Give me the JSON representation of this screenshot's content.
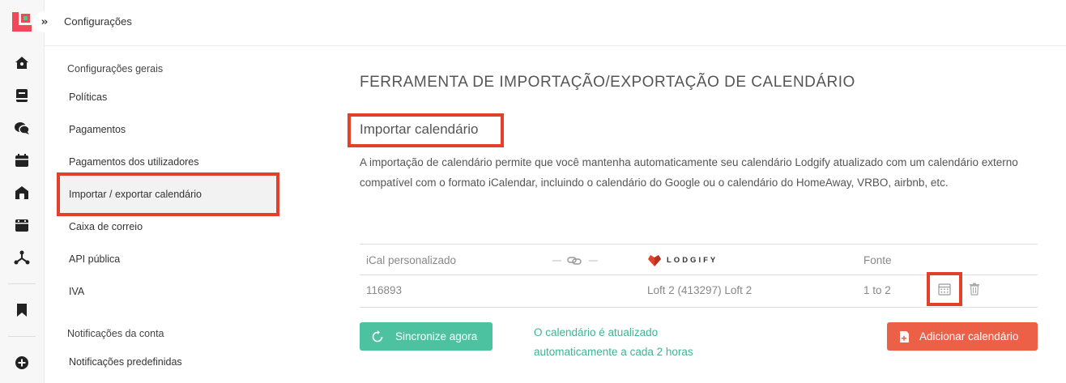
{
  "header": {
    "title": "Configurações"
  },
  "rail": {
    "icons": [
      "home-icon",
      "book-icon",
      "chat-icon",
      "calendar-icon",
      "house-icon",
      "calendar-board-icon",
      "network-icon",
      "bookmark-icon",
      "add-icon"
    ]
  },
  "settings_nav": {
    "general_heading": "Configurações gerais",
    "items": [
      {
        "label": "Políticas"
      },
      {
        "label": "Pagamentos"
      },
      {
        "label": "Pagamentos dos utilizadores"
      },
      {
        "label": "Importar / exportar calendário",
        "active": true
      },
      {
        "label": "Caixa de correio"
      },
      {
        "label": "API pública"
      },
      {
        "label": "IVA"
      }
    ],
    "account_heading": "Notificações da conta",
    "account_items": [
      {
        "label": "Notificações predefinidas"
      }
    ]
  },
  "main": {
    "title": "FERRAMENTA DE IMPORTAÇÃO/EXPORTAÇÃO DE CALENDÁRIO",
    "subtitle": "Importar calendário",
    "description": "A importação de calendário permite que você mantenha automaticamente seu calendário Lodgify atualizado com um calendário externo compatível com o formato iCalendar, incluindo o calendário do Google ou o calendário do HomeAway, VRBO, airbnb, etc.",
    "table": {
      "headers": {
        "ical": "iCal personalizado",
        "link_symbol": "— ⊶ —",
        "brand": "LODGIFY",
        "source": "Fonte"
      },
      "rows": [
        {
          "ical": "116893",
          "property": "Loft 2 (413297) Loft 2",
          "source": "1 to 2"
        }
      ]
    },
    "sync_button": "Sincronize agora",
    "sync_note_line1": "O calendário é atualizado",
    "sync_note_line2": "automaticamente a cada 2 horas",
    "add_button": "Adicionar calendário"
  },
  "colors": {
    "highlight": "#e2402a",
    "sync_button": "#4cc2a0",
    "add_button": "#ec6048",
    "logo_red": "#f04a5a",
    "logo_green": "#3ecf9b"
  }
}
